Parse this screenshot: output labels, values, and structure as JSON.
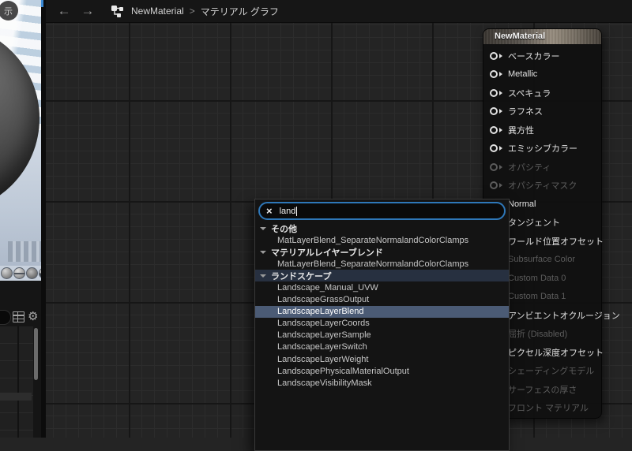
{
  "toolbar": {
    "back_arrow": "←",
    "forward_arrow": "→",
    "breadcrumb_root": "NewMaterial",
    "breadcrumb_separator": ">",
    "breadcrumb_current": "マテリアル グラフ"
  },
  "viewport": {
    "show_badge": "示",
    "preview_shapes": [
      "cylinder",
      "plane",
      "cube",
      "teapot"
    ]
  },
  "node": {
    "title": "NewMaterial",
    "pins": [
      {
        "label": "ベースカラー",
        "enabled": true
      },
      {
        "label": "Metallic",
        "enabled": true
      },
      {
        "label": "スペキュラ",
        "enabled": true
      },
      {
        "label": "ラフネス",
        "enabled": true
      },
      {
        "label": "異方性",
        "enabled": true
      },
      {
        "label": "エミッシブカラー",
        "enabled": true
      },
      {
        "label": "オパシティ",
        "enabled": false
      },
      {
        "label": "オパシティマスク",
        "enabled": false
      },
      {
        "label": "Normal",
        "enabled": true
      },
      {
        "label": "タンジェント",
        "enabled": true
      },
      {
        "label": "ワールド位置オフセット",
        "enabled": true
      },
      {
        "label": "Subsurface Color",
        "enabled": false
      },
      {
        "label": "Custom Data 0",
        "enabled": false
      },
      {
        "label": "Custom Data 1",
        "enabled": false
      },
      {
        "label": "アンビエントオクルージョン",
        "enabled": true
      },
      {
        "label": "屈折 (Disabled)",
        "enabled": false
      },
      {
        "label": "ピクセル深度オフセット",
        "enabled": true
      },
      {
        "label": "シェーディングモデル",
        "enabled": false
      },
      {
        "label": "サーフェスの厚さ",
        "enabled": false
      },
      {
        "label": "フロント マテリアル",
        "enabled": false
      }
    ]
  },
  "popup": {
    "clear_icon": "×",
    "search_value": "land",
    "rows": [
      {
        "type": "header",
        "label": "その他"
      },
      {
        "type": "item",
        "label": "MatLayerBlend_SeparateNormalandColorClamps"
      },
      {
        "type": "header",
        "label": "マテリアルレイヤーブレンド"
      },
      {
        "type": "item",
        "label": "MatLayerBlend_SeparateNormalandColorClamps"
      },
      {
        "type": "header",
        "label": "ランドスケープ",
        "tinted": true
      },
      {
        "type": "item",
        "label": "Landscape_Manual_UVW"
      },
      {
        "type": "item",
        "label": "LandscapeGrassOutput"
      },
      {
        "type": "item",
        "label": "LandscapeLayerBlend",
        "selected": true
      },
      {
        "type": "item",
        "label": "LandscapeLayerCoords"
      },
      {
        "type": "item",
        "label": "LandscapeLayerSample"
      },
      {
        "type": "item",
        "label": "LandscapeLayerSwitch"
      },
      {
        "type": "item",
        "label": "LandscapeLayerWeight"
      },
      {
        "type": "item",
        "label": "LandscapePhysicalMaterialOutput"
      },
      {
        "type": "item",
        "label": "LandscapeVisibilityMask"
      }
    ]
  },
  "colors": {
    "selection": "#4b5b75",
    "search_focus_border": "#2e77b8",
    "graph_background": "#242424",
    "node_header": "#968c7e"
  }
}
